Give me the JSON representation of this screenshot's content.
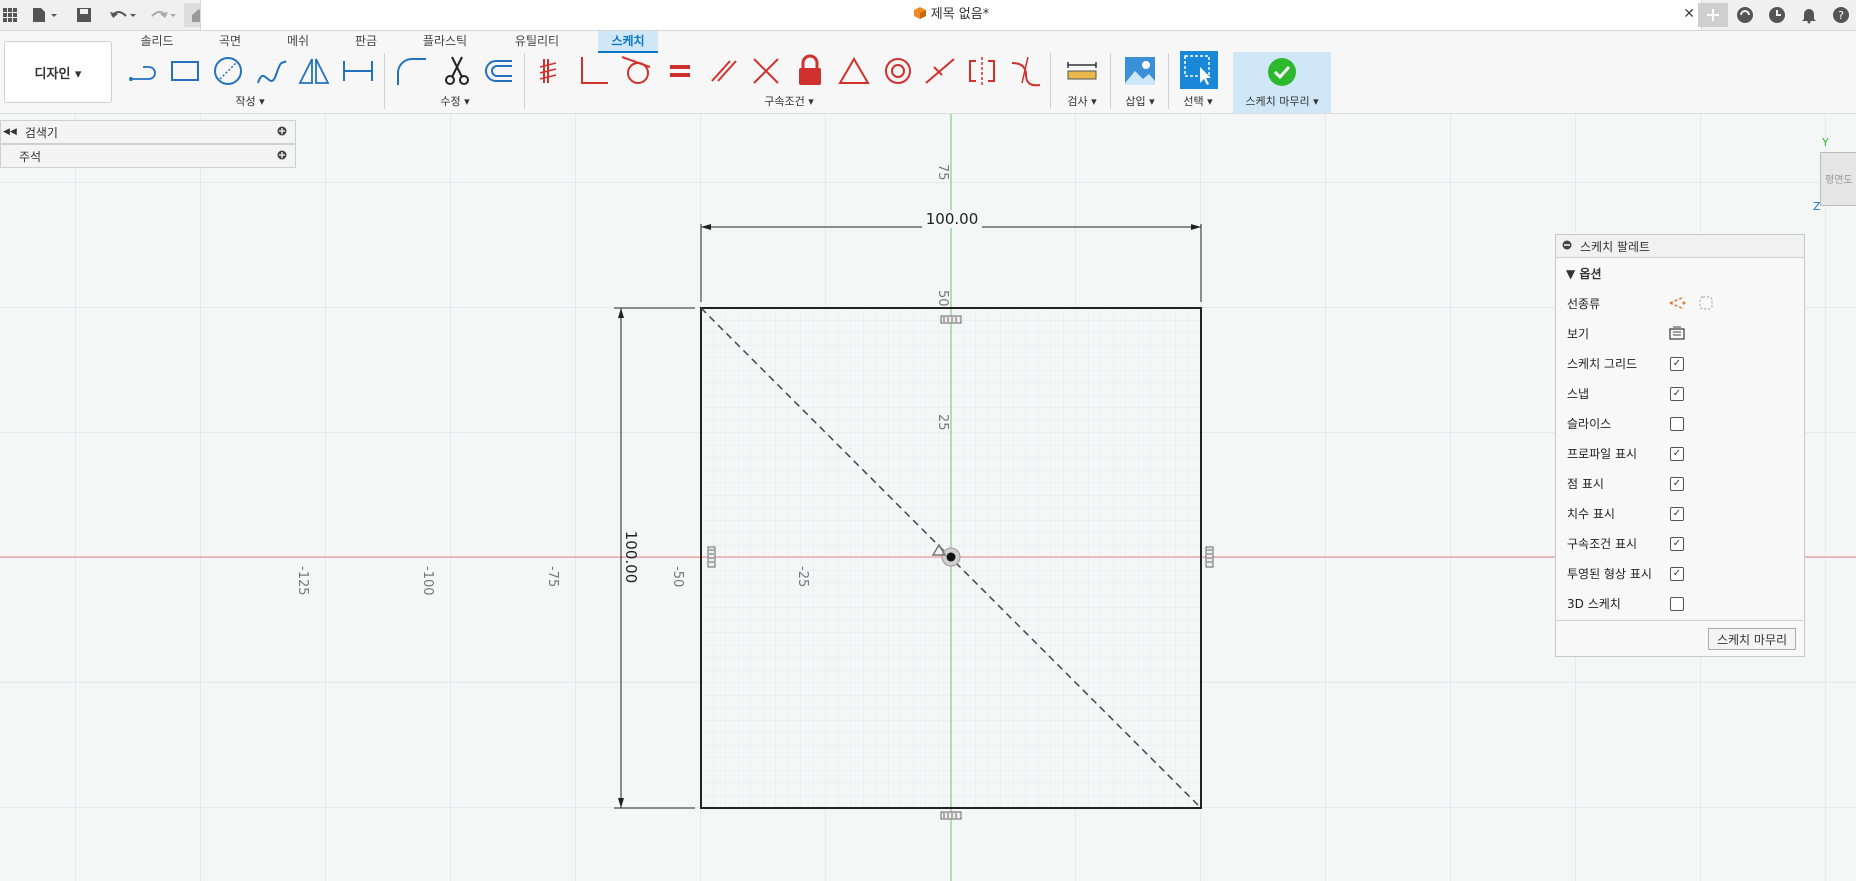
{
  "app": {
    "document_title": "제목 없음*"
  },
  "toolbar": {
    "workspace_label": "디자인 ▾",
    "tabs": [
      "솔리드",
      "곡면",
      "메쉬",
      "판금",
      "플라스틱",
      "유틸리티",
      "스케치"
    ],
    "active_tab": "스케치",
    "groups": {
      "create": "작성 ▾",
      "modify": "수정 ▾",
      "constraints": "구속조건 ▾",
      "inspect": "검사 ▾",
      "insert": "삽입 ▾",
      "select": "선택 ▾",
      "finish_sketch": "스케치 마무리 ▾"
    }
  },
  "browser": {
    "rows": [
      "검색기",
      "주석"
    ]
  },
  "canvas": {
    "vertical_ruler": [
      "75",
      "50",
      "25"
    ],
    "horizontal_ruler": [
      "-125",
      "-100",
      "-75",
      "-50",
      "-25"
    ],
    "dim_horizontal": "100.00",
    "dim_vertical": "100.00"
  },
  "palette": {
    "title": "스케치 팔레트",
    "section": "옵션",
    "rows": [
      {
        "label": "선종류",
        "type": "icons"
      },
      {
        "label": "보기",
        "type": "icon"
      },
      {
        "label": "스케치 그리드",
        "type": "checkbox",
        "checked": true
      },
      {
        "label": "스냅",
        "type": "checkbox",
        "checked": true
      },
      {
        "label": "슬라이스",
        "type": "checkbox",
        "checked": false
      },
      {
        "label": "프로파일 표시",
        "type": "checkbox",
        "checked": true
      },
      {
        "label": "점 표시",
        "type": "checkbox",
        "checked": true
      },
      {
        "label": "치수 표시",
        "type": "checkbox",
        "checked": true
      },
      {
        "label": "구속조건 표시",
        "type": "checkbox",
        "checked": true
      },
      {
        "label": "투영된 형상 표시",
        "type": "checkbox",
        "checked": true
      },
      {
        "label": "3D 스케치",
        "type": "checkbox",
        "checked": false
      }
    ],
    "finish_button": "스케치 마무리"
  },
  "viewcube": {
    "axis_y": "Y",
    "axis_z": "Z",
    "face_label": "평면도"
  },
  "colors": {
    "accent": "#0b75c7",
    "tab_active_bg": "#cfe7f6",
    "x_axis": "#e88888",
    "y_axis": "#7ed27e",
    "constraint_red": "#d0312d",
    "finish_green": "#2eb82e"
  }
}
